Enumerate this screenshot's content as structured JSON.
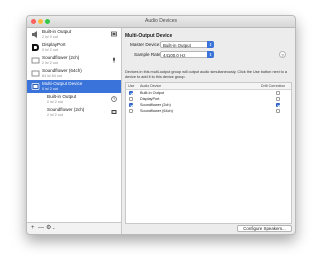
{
  "window": {
    "title": "Audio Devices"
  },
  "sidebar": {
    "devices": [
      {
        "name": "Built-in Output",
        "sub": "2 in/ 0 out"
      },
      {
        "name": "DisplayPort",
        "sub": "0 in/ 2 out"
      },
      {
        "name": "Soundflower (2ch)",
        "sub": "2 in/ 2 out"
      },
      {
        "name": "Soundflower (64ch)",
        "sub": "64 in/ 64 out"
      },
      {
        "name": "Multi-Output Device",
        "sub": "0 in/ 2 out"
      },
      {
        "name": "Built-in Output",
        "sub": "0 in/ 2 out"
      },
      {
        "name": "Soundflower (2ch)",
        "sub": "2 in/ 2 out"
      }
    ],
    "footer": {
      "add": "+",
      "remove": "—",
      "gear": "⚙",
      "gear_menu": "⌄"
    }
  },
  "main": {
    "title": "Multi-Output Device",
    "master_label": "Master Device:",
    "master_value": "Built-in Output",
    "rate_label": "Sample Rate:",
    "rate_value": "44100.0 Hz",
    "help": "?",
    "description": "Devices in this multi-output group will output audio simultaneously. Click the Use button next to a device to add it to this device group.",
    "table": {
      "headers": {
        "use": "Use",
        "device": "Audio Device",
        "drift": "Drift Correction"
      },
      "rows": [
        {
          "device": "Built-in Output",
          "use": true,
          "drift": false
        },
        {
          "device": "DisplayPort",
          "use": false,
          "drift": false
        },
        {
          "device": "Soundflower (2ch)",
          "use": true,
          "drift": true
        },
        {
          "device": "Soundflower (64ch)",
          "use": false,
          "drift": false
        }
      ]
    },
    "configure_button": "Configure Speakers..."
  }
}
